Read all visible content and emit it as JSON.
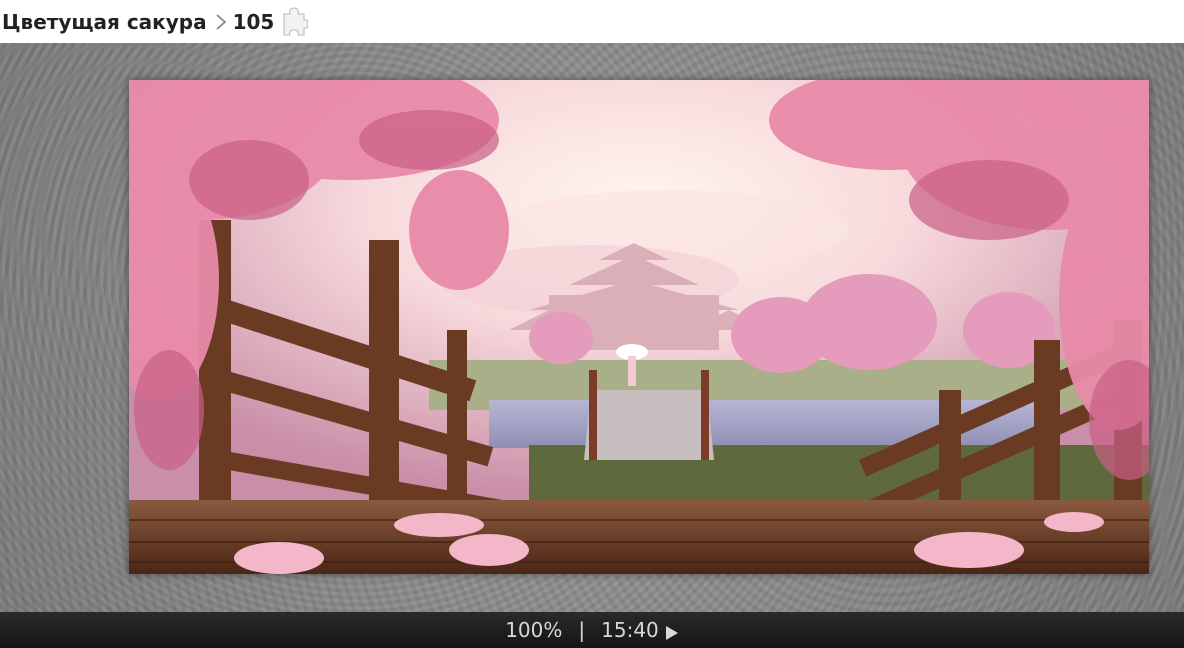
{
  "breadcrumb": {
    "category": "Цветущая сакура",
    "pieces": "105"
  },
  "icons": {
    "separator": "chevron-right-icon",
    "puzzle": "puzzle-piece-icon",
    "play": "play-icon"
  },
  "footer": {
    "zoom": "100%",
    "divider": "|",
    "timer": "15:40"
  },
  "colors": {
    "board_bg": "#8d8d8d",
    "footer_bg": "#1c1c1c",
    "footer_text": "#d8d8d8",
    "header_text": "#222222",
    "blossom": "#e98aa8",
    "sky": "#f6d6dd",
    "wood": "#6b3a22"
  }
}
